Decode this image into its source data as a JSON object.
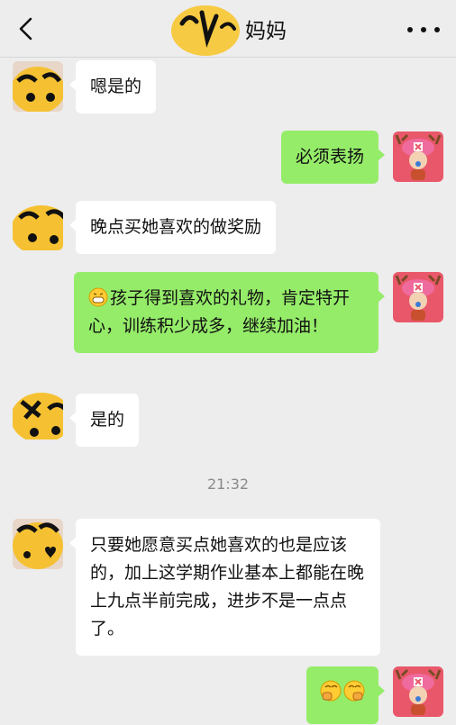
{
  "header": {
    "title": "妈妈",
    "back_icon": "chevron-left-icon",
    "more_icon": "more-dots-icon"
  },
  "messages": [
    {
      "side": "left",
      "text": "嗯是的"
    },
    {
      "side": "right",
      "text": "必须表扬"
    },
    {
      "side": "left",
      "text": "晚点买她喜欢的做奖励"
    },
    {
      "side": "right",
      "emoji": "grinning-face-emoji",
      "text": "孩子得到喜欢的礼物，肯定特开心，训练积少成多，继续加油！"
    },
    {
      "side": "left",
      "text": "是的"
    },
    {
      "side": "left",
      "text": "只要她愿意买点她喜欢的也是应该的，加上这学期作业基本上都能在晚上九点半前完成，进步不是一点点了。"
    },
    {
      "side": "right",
      "emoji": "fist-emoji-pair",
      "text": ""
    }
  ],
  "timestamp": "21:32",
  "colors": {
    "background": "#ededed",
    "incoming_bubble": "#ffffff",
    "outgoing_bubble": "#95ec69"
  }
}
